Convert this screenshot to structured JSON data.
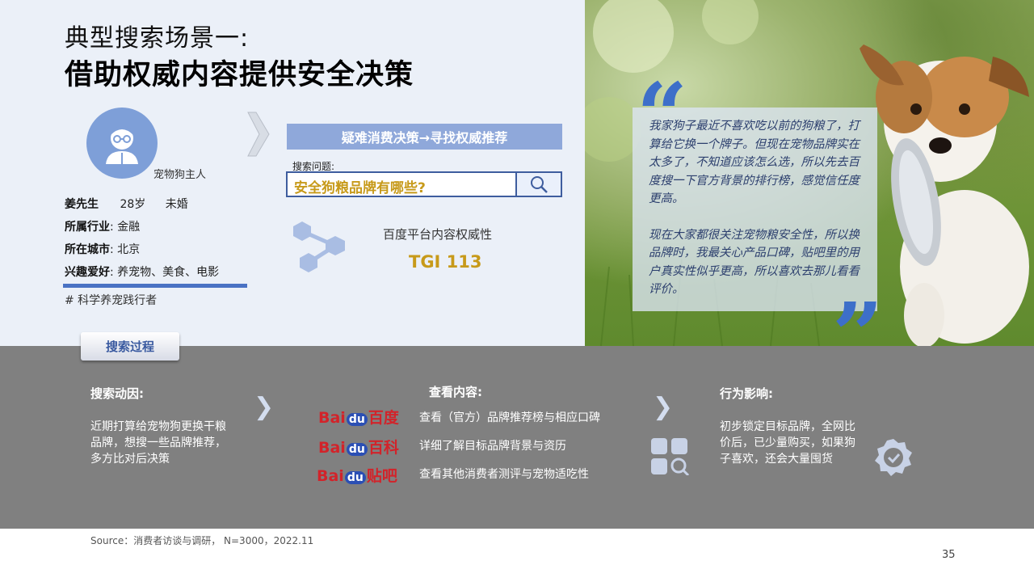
{
  "title": {
    "line1": "典型搜索场景一:",
    "line2": "借助权威内容提供安全决策"
  },
  "persona": {
    "role": "宠物狗主人",
    "name": "姜先生",
    "age": "28岁",
    "marital": "未婚",
    "industry_label": "所属行业",
    "industry": "金融",
    "city_label": "所在城市",
    "city": "北京",
    "hobby_label": "兴趣爱好",
    "hobby": "养宠物、美食、电影",
    "tag": "# 科学养宠践行者",
    "colon": ":"
  },
  "search": {
    "banner": "疑难消费决策→寻找权威推荐",
    "question_label": "搜索问题:",
    "query": "安全狗粮品牌有哪些?",
    "authority_label": "百度平台内容权威性",
    "tgi": "TGI 113"
  },
  "quote": {
    "open": "“",
    "close": "”",
    "p1": "我家狗子最近不喜欢吃以前的狗粮了，打算给它换一个牌子。但现在宠物品牌实在太多了，不知道应该怎么选，所以先去百度搜一下官方背景的排行榜，感觉信任度更高。",
    "p2": "现在大家都很关注宠物粮安全性，所以换品牌时，我最关心产品口碑，贴吧里的用户真实性似乎更高，所以喜欢去那儿看看评价。"
  },
  "process": {
    "tab": "搜索过程",
    "motive_head": "搜索动因:",
    "motive_body": "近期打算给宠物狗更换干粮品牌，想搜一些品牌推荐，多方比对后决策",
    "content_head": "查看内容:",
    "items": [
      {
        "brand_prefix": "Bai",
        "brand_du": "du",
        "brand_name": "百度",
        "text": "查看（官方）品牌推荐榜与相应口碑"
      },
      {
        "brand_prefix": "Bai",
        "brand_du": "du",
        "brand_name": "百科",
        "text": "详细了解目标品牌背景与资历"
      },
      {
        "brand_prefix": "Bai",
        "brand_du": "du",
        "brand_name": "贴吧",
        "text": "查看其他消费者测评与宠物适吃性"
      }
    ],
    "impact_head": "行为影响:",
    "impact_body": "初步锁定目标品牌，全网比价后，已少量购买，如果狗子喜欢，还会大量囤货",
    "chevron": "❯"
  },
  "footer": {
    "source": "Source：消费者访谈与调研， N=3000，2022.11",
    "page": "35"
  },
  "colors": {
    "accent_blue": "#4a72c4",
    "gold": "#c79a1a",
    "band_gray": "#808080"
  }
}
